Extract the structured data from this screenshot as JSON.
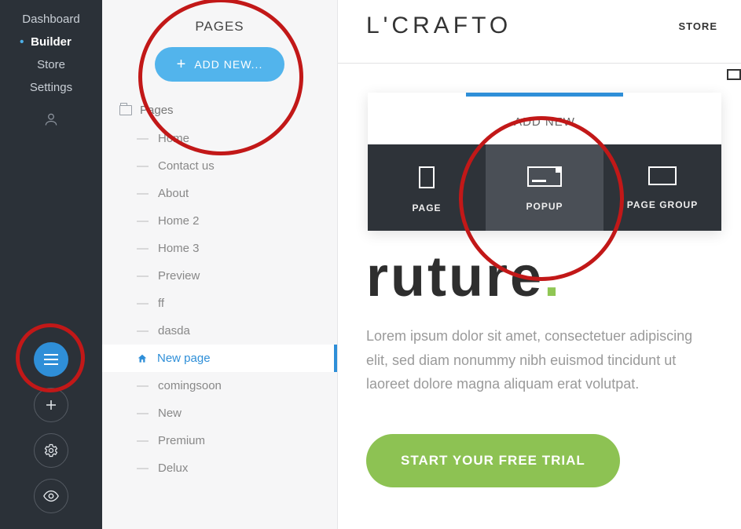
{
  "leftbar": {
    "items": [
      {
        "label": "Dashboard",
        "active": false
      },
      {
        "label": "Builder",
        "active": true
      },
      {
        "label": "Store",
        "active": false
      },
      {
        "label": "Settings",
        "active": false
      }
    ]
  },
  "panel": {
    "title": "PAGES",
    "add_button": "ADD NEW...",
    "folder_label": "Pages",
    "pages": [
      {
        "label": "Home"
      },
      {
        "label": "Contact us"
      },
      {
        "label": "About"
      },
      {
        "label": "Home 2"
      },
      {
        "label": "Home 3"
      },
      {
        "label": "Preview"
      },
      {
        "label": "ff"
      },
      {
        "label": "dasda"
      },
      {
        "label": "New page",
        "active": true
      },
      {
        "label": "comingsoon"
      },
      {
        "label": "New"
      },
      {
        "label": "Premium"
      },
      {
        "label": "Delux"
      }
    ]
  },
  "preview": {
    "site_title": "L'CRAFTO",
    "store_link": "STORE",
    "headline_partial": "ruture",
    "headline_dot": ".",
    "paragraph": "Lorem ipsum dolor sit amet, consectetuer adipiscing elit, sed diam nonummy nibh euismod tincidunt ut laoreet dolore magna aliquam erat volutpat.",
    "cta": "START YOUR FREE TRIAL"
  },
  "addnew": {
    "title": "ADD NEW",
    "opts": [
      {
        "label": "PAGE"
      },
      {
        "label": "POPUP"
      },
      {
        "label": "PAGE GROUP"
      }
    ]
  },
  "colors": {
    "accent": "#2f8fd8",
    "success": "#8dc253",
    "danger": "#c21818",
    "dark": "#2b3138"
  }
}
